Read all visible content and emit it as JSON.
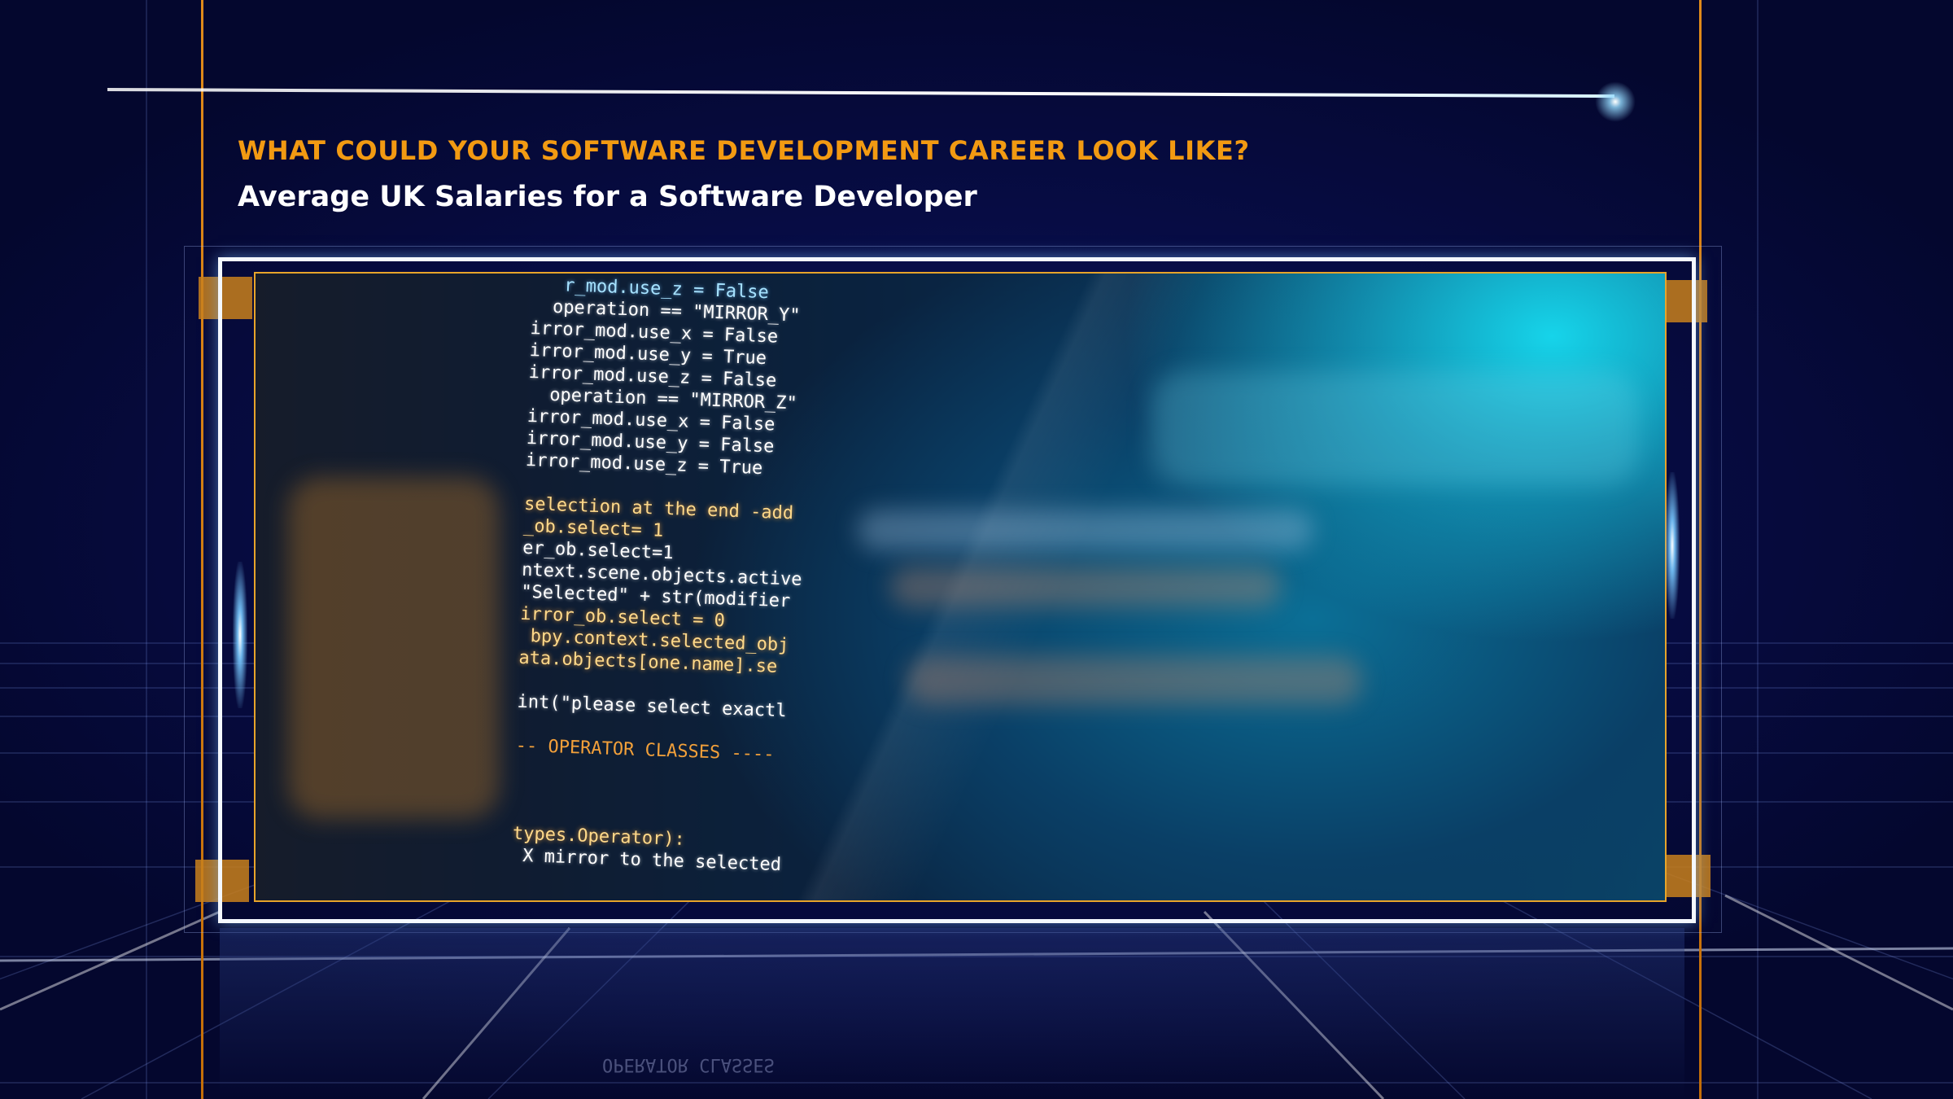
{
  "header": {
    "headline": "WHAT COULD YOUR SOFTWARE DEVELOPMENT CAREER LOOK LIKE?",
    "subheadline": "Average UK Salaries for a Software Developer"
  },
  "image": {
    "code_lines": [
      {
        "text": "   r_mod.use_z = False",
        "color": "b"
      },
      {
        "text": "  operation == \"MIRROR_Y\"",
        "color": "w"
      },
      {
        "text": "irror_mod.use_x = False",
        "color": "w"
      },
      {
        "text": "irror_mod.use_y = True",
        "color": "w"
      },
      {
        "text": "irror_mod.use_z = False",
        "color": "w"
      },
      {
        "text": "  operation == \"MIRROR_Z\"",
        "color": "w"
      },
      {
        "text": "irror_mod.use_x = False",
        "color": "w"
      },
      {
        "text": "irror_mod.use_y = False",
        "color": "w"
      },
      {
        "text": "irror_mod.use_z = True",
        "color": "w"
      },
      {
        "text": "",
        "color": "w"
      },
      {
        "text": "selection at the end -add",
        "color": "y"
      },
      {
        "text": "_ob.select= 1",
        "color": "y"
      },
      {
        "text": "er_ob.select=1",
        "color": "w"
      },
      {
        "text": "ntext.scene.objects.active",
        "color": "w"
      },
      {
        "text": "\"Selected\" + str(modifier",
        "color": "w"
      },
      {
        "text": "irror_ob.select = 0",
        "color": "y"
      },
      {
        "text": " bpy.context.selected_obj",
        "color": "y"
      },
      {
        "text": "ata.objects[one.name].se",
        "color": "y"
      },
      {
        "text": "",
        "color": "w"
      },
      {
        "text": "int(\"please select exactl",
        "color": "w"
      },
      {
        "text": "",
        "color": "w"
      },
      {
        "text": "-- OPERATOR CLASSES ----",
        "color": "o"
      },
      {
        "text": "",
        "color": "w"
      },
      {
        "text": "",
        "color": "w"
      },
      {
        "text": "",
        "color": "w"
      },
      {
        "text": "types.Operator):",
        "color": "y"
      },
      {
        "text": " X mirror to the selected",
        "color": "w"
      }
    ],
    "reflection_text": "OPERATOR CLASSES"
  },
  "colors": {
    "background": "#05093a",
    "accent_orange": "#f29a12",
    "frame_white": "#f4f8ff",
    "screen_cyan": "#16d4ea"
  }
}
